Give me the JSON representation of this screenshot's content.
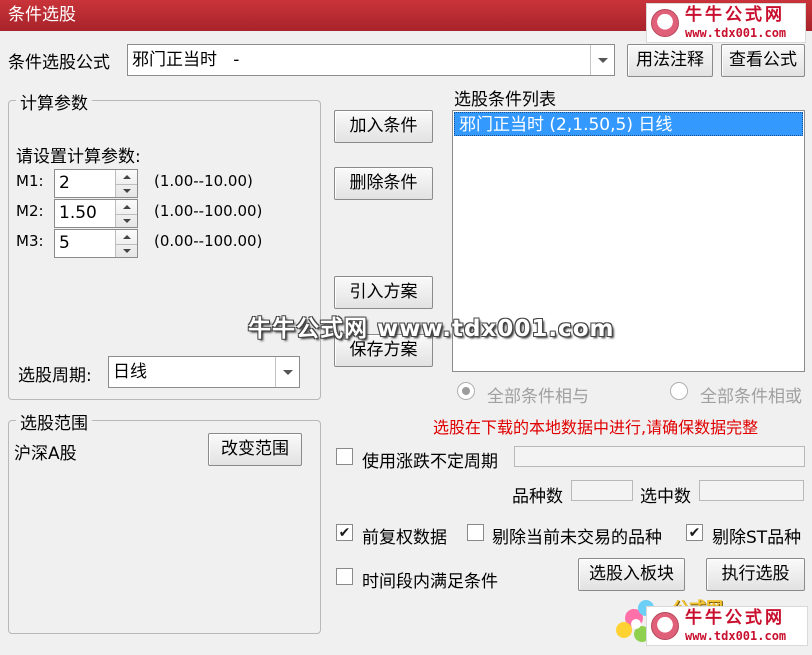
{
  "window": {
    "title": "条件选股"
  },
  "watermark": {
    "brand": "牛牛公式网",
    "url": "www.tdx001.com",
    "overlay": "牛牛公式网 www.tdx001.com",
    "partial_brand": "公式网"
  },
  "formula": {
    "label": "条件选股公式",
    "value": "邪门正当时   -",
    "usage_button": "用法注释",
    "view_button": "查看公式"
  },
  "params": {
    "group_title": "计算参数",
    "prompt": "请设置计算参数:",
    "rows": [
      {
        "label": "M1:",
        "value": "2",
        "range": "(1.00--10.00)"
      },
      {
        "label": "M2:",
        "value": "1.50",
        "range": "(1.00--100.00)"
      },
      {
        "label": "M3:",
        "value": "5",
        "range": "(0.00--100.00)"
      }
    ],
    "period_label": "选股周期:",
    "period_value": "日线"
  },
  "actions": {
    "add": "加入条件",
    "delete": "删除条件",
    "import": "引入方案",
    "save": "保存方案"
  },
  "condition_list": {
    "title": "选股条件列表",
    "items": [
      "邪门正当时 (2,1.50,5) 日线"
    ]
  },
  "logic": {
    "and_label": "全部条件相与",
    "or_label": "全部条件相或"
  },
  "warning": "选股在下载的本地数据中进行,请确保数据完整",
  "range": {
    "group_title": "选股范围",
    "value": "沪深A股",
    "change_button": "改变范围"
  },
  "options": {
    "use_indefinite_period": "使用涨跌不定周期",
    "variety_count_label": "品种数",
    "selected_count_label": "选中数",
    "forward_adjust": "前复权数据",
    "exclude_untraded": "剔除当前未交易的品种",
    "exclude_st": "剔除ST品种",
    "time_segment": "时间段内满足条件"
  },
  "bottom_buttons": {
    "to_block": "选股入板块",
    "execute": "执行选股"
  },
  "colors": {
    "title_bg": "#b52a31",
    "selection": "#3399ff",
    "warning": "#e00000"
  }
}
